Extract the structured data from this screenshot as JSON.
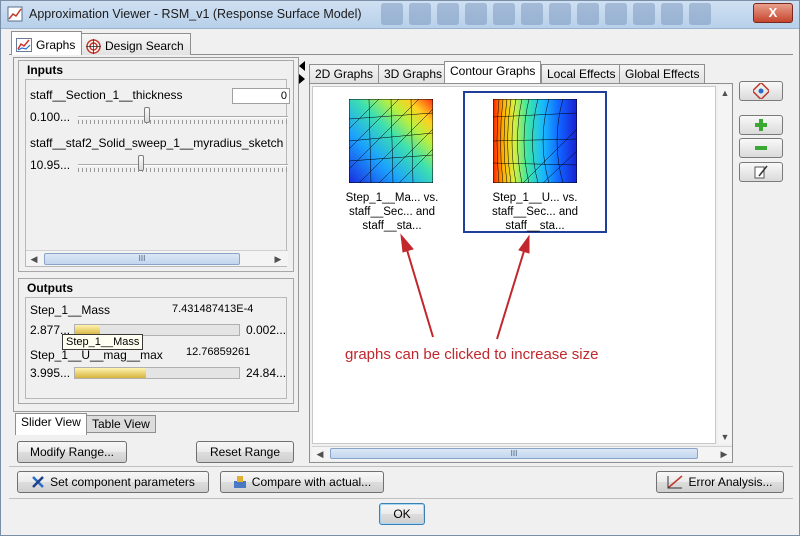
{
  "window": {
    "title": "Approximation Viewer - RSM_v1 (Response Surface Model)",
    "close_label": "X"
  },
  "top_tabs": [
    {
      "label": "Graphs",
      "icon": "line-chart-icon",
      "active": true
    },
    {
      "label": "Design Search",
      "icon": "target-icon",
      "active": false
    }
  ],
  "inputs": {
    "title": "Inputs",
    "items": [
      {
        "name": "staff__Section_1__thickness",
        "field_value": "0",
        "min_label": "0.100...",
        "level": 0.33
      },
      {
        "name": "staff__staf2_Solid_sweep_1__myradius_sketch",
        "min_label": "10.95...",
        "level": 0.3
      }
    ]
  },
  "outputs": {
    "title": "Outputs",
    "items": [
      {
        "name": "Step_1__Mass",
        "value": "7.431487413E-4",
        "min_label": "2.877...",
        "max_label": "0.002...",
        "level": 0.15
      },
      {
        "name": "Step_1__U__mag__max",
        "value": "12.76859261",
        "min_label": "3.995...",
        "max_label": "24.84...",
        "level": 0.43
      }
    ],
    "tooltip": "Step_1__Mass"
  },
  "view_tabs": [
    {
      "label": "Slider View",
      "active": true
    },
    {
      "label": "Table View",
      "active": false
    }
  ],
  "left_buttons": {
    "modify_range": "Modify Range...",
    "reset_range": "Reset Range"
  },
  "graph_tabs": [
    {
      "label": "2D Graphs",
      "active": false
    },
    {
      "label": "3D Graphs",
      "active": false
    },
    {
      "label": "Contour Graphs",
      "active": true
    },
    {
      "label": "Local Effects",
      "active": false
    },
    {
      "label": "Global Effects",
      "active": false
    }
  ],
  "graphs": [
    {
      "caption": [
        "Step_1__Ma... vs.",
        "staff__Sec... and",
        "staff__sta..."
      ],
      "selected": false
    },
    {
      "caption": [
        "Step_1__U... vs.",
        "staff__Sec... and",
        "staff__sta..."
      ],
      "selected": true
    }
  ],
  "annotation": "graphs can be clicked to increase size",
  "scroll_grip": "III",
  "bottom_buttons": {
    "set_params": "Set component parameters",
    "compare": "Compare with actual...",
    "error_analysis": "Error Analysis...",
    "ok": "OK"
  },
  "side_buttons": [
    "settings-icon",
    "add-icon",
    "remove-icon",
    "edit-icon"
  ],
  "colors": {
    "annotation": "#c1272d",
    "selection": "#1f3f9a"
  }
}
